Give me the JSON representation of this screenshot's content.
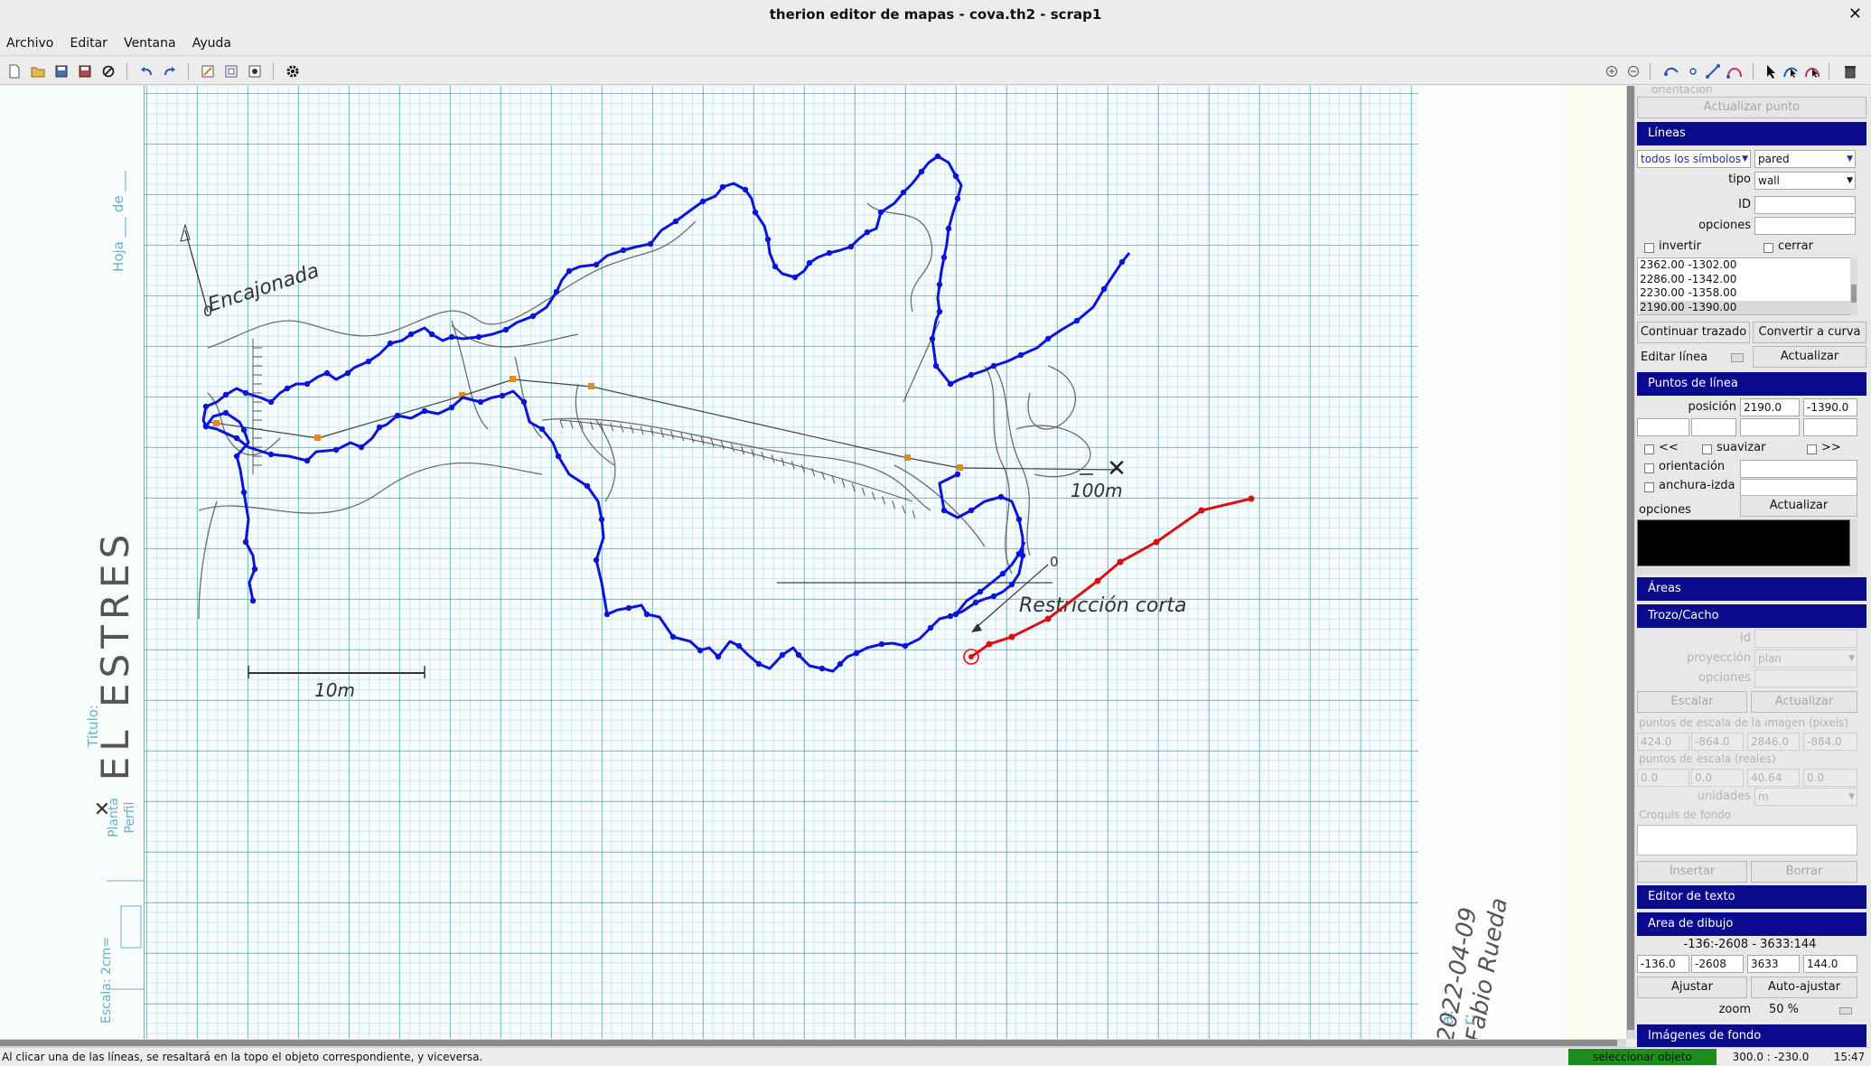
{
  "window": {
    "title": "therion editor de mapas - cova.th2 - scrap1",
    "close_glyph": "✕"
  },
  "menu": [
    "Archivo",
    "Editar",
    "Ventana",
    "Ayuda"
  ],
  "toolbar": {
    "left_icons": [
      "new-file-icon",
      "open-folder-icon",
      "save-icon",
      "save-as-icon",
      "close-file-icon",
      "undo-icon",
      "redo-icon",
      "edit-text-icon",
      "edit-scrap-icon",
      "edit-settings-icon",
      "compile-gear-icon"
    ],
    "right_icons": [
      "zoom-in-icon",
      "zoom-out-icon",
      "insert-point-icon",
      "insert-line-icon",
      "insert-area-icon",
      "select-icon",
      "edit-line-icon",
      "edit-area-icon",
      "trash-icon"
    ]
  },
  "sketch": {
    "margin_hoja": "Hoja ___ de ___",
    "margin_cave_name": "EL ESTRES",
    "margin_titulo": "Título:",
    "margin_planta": "Planta",
    "margin_perfil": "Perfil",
    "margin_escala": "Escala: 2cm=",
    "label_encajonada": "Encajonada",
    "label_encajonada_point": "0",
    "label_100m": "100m",
    "label_restriccion": "Restricción corta",
    "label_restriccion_point": "0",
    "label_10m": "10m",
    "date": "2022-04-09",
    "author": "Fabio Rueda",
    "margin_a": "a:",
    "margin_r": "r:"
  },
  "panel": {
    "orientacion_top": "orientación",
    "actualizar_punto": "Actualizar punto",
    "lineas": {
      "header": "Líneas",
      "filter": "todos los símbolos",
      "symbol": "pared",
      "tipo_label": "tipo",
      "tipo": "wall",
      "id_label": "ID",
      "opciones_label": "opciones",
      "invertir": "invertir",
      "cerrar": "cerrar",
      "points": [
        "2362.00 -1302.00",
        "2286.00 -1342.00",
        "2230.00 -1358.00",
        "2190.00 -1390.00"
      ],
      "continuar_trazado": "Continuar trazado",
      "convertir_curva": "Convertir a curva",
      "editar_linea": "Editar línea",
      "actualizar": "Actualizar"
    },
    "puntos_linea": {
      "header": "Puntos de línea",
      "posicion_label": "posición",
      "x": "2190.0",
      "y": "-1390.0",
      "prev": "<<",
      "suavizar": "suavizar",
      "next": ">>",
      "orientacion": "orientación",
      "anchura": "anchura-izda",
      "opciones_label": "opciones",
      "actualizar": "Actualizar"
    },
    "areas_header": "Áreas",
    "trozo": {
      "header": "Trozo/Cacho",
      "id_label": "id",
      "proyeccion_label": "proyección",
      "proyeccion": "plan",
      "opciones_label": "opciones",
      "escalar": "Escalar",
      "actualizar": "Actualizar",
      "img_scale_label": "puntos de escala de la imagen (pixels)",
      "img_scale": [
        "424.0",
        "-864.0",
        "2846.0",
        "-884.0"
      ],
      "real_scale_label": "puntos de escala (reales)",
      "real_scale": [
        "0.0",
        "0.0",
        "40.64",
        "0.0"
      ],
      "unidades_label": "unidades",
      "unidades": "m",
      "croquis_label": "Croquis de fondo",
      "insertar": "Insertar",
      "borrar": "Borrar"
    },
    "editor_texto_header": "Editor de texto",
    "area_dibujo": {
      "header": "Area de dibujo",
      "summary": "-136:-2608 - 3633:144",
      "values": [
        "-136.0",
        "-2608",
        "3633",
        "144.0"
      ],
      "ajustar": "Ajustar",
      "auto_ajustar": "Auto-ajustar",
      "zoom_label": "zoom",
      "zoom": "50 %"
    },
    "imagenes_fondo_header": "Imágenes de fondo"
  },
  "status": {
    "message": "Al clicar una de las líneas, se resaltará en la topo el objeto correspondiente, y viceversa.",
    "mode": "seleccionar objeto",
    "coords": "300.0 : -230.0",
    "time": "15:47"
  },
  "colors": {
    "wall_line": "#0a14d8",
    "selected_line": "#d81010",
    "header_blue": "#0a0a8c",
    "status_green": "#1e8c1e",
    "station_orange": "#e08a20"
  }
}
